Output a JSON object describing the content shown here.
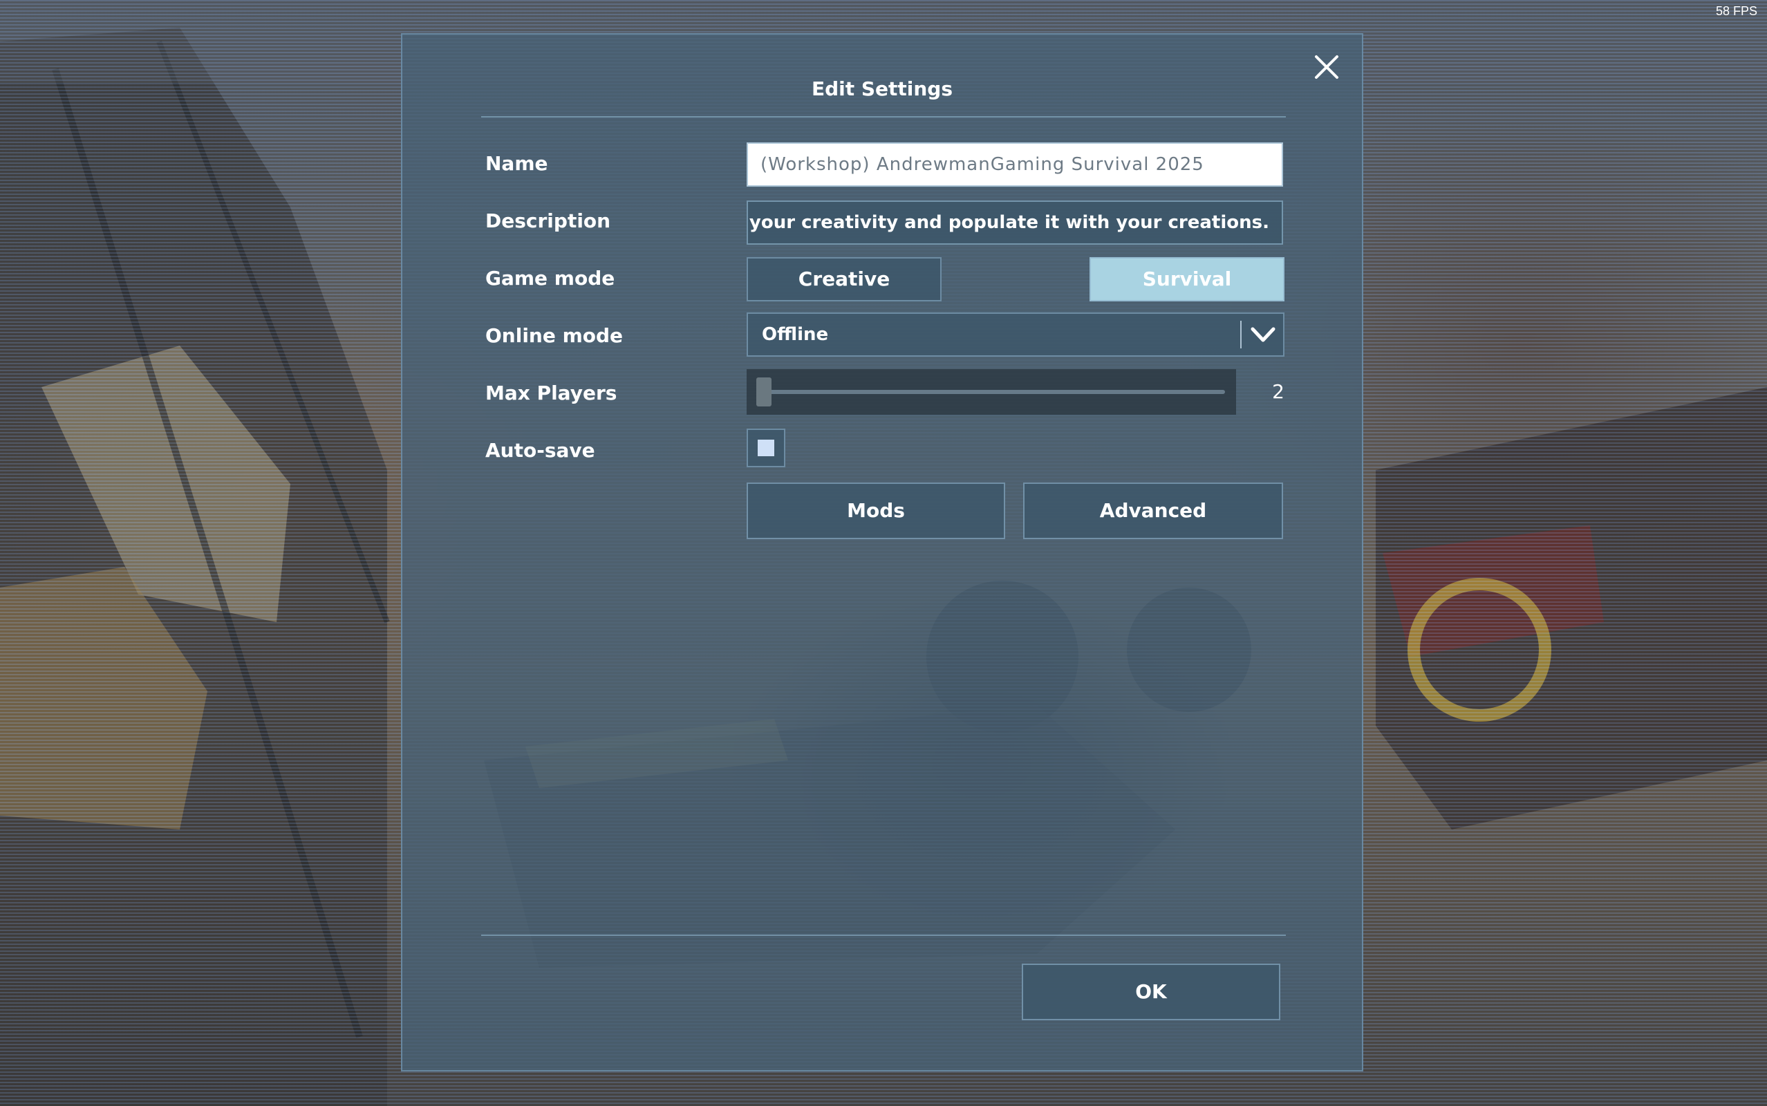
{
  "overlay": {
    "fps": "58 FPS"
  },
  "dialog": {
    "title": "Edit Settings",
    "fields": {
      "name_label": "Name",
      "name_value": "(Workshop) AndrewmanGaming Survival 2025",
      "description_label": "Description",
      "description_value": "ash your creativity and populate it with your creations.",
      "game_mode_label": "Game mode",
      "game_mode_options": [
        "Creative",
        "Survival"
      ],
      "game_mode_selected": "Survival",
      "online_mode_label": "Online mode",
      "online_mode_value": "Offline",
      "max_players_label": "Max Players",
      "max_players_value": "2",
      "max_players_fraction": 0.0,
      "autosave_label": "Auto-save",
      "autosave_checked": true
    },
    "buttons": {
      "mods": "Mods",
      "advanced": "Advanced",
      "ok": "OK"
    },
    "icons": {
      "close": "close-icon",
      "dropdown": "chevron-down-icon"
    },
    "colors": {
      "selected_mode": "#a9d3e2",
      "panel": "#48627a",
      "checkbox_fill": "#cfe0f7"
    }
  }
}
